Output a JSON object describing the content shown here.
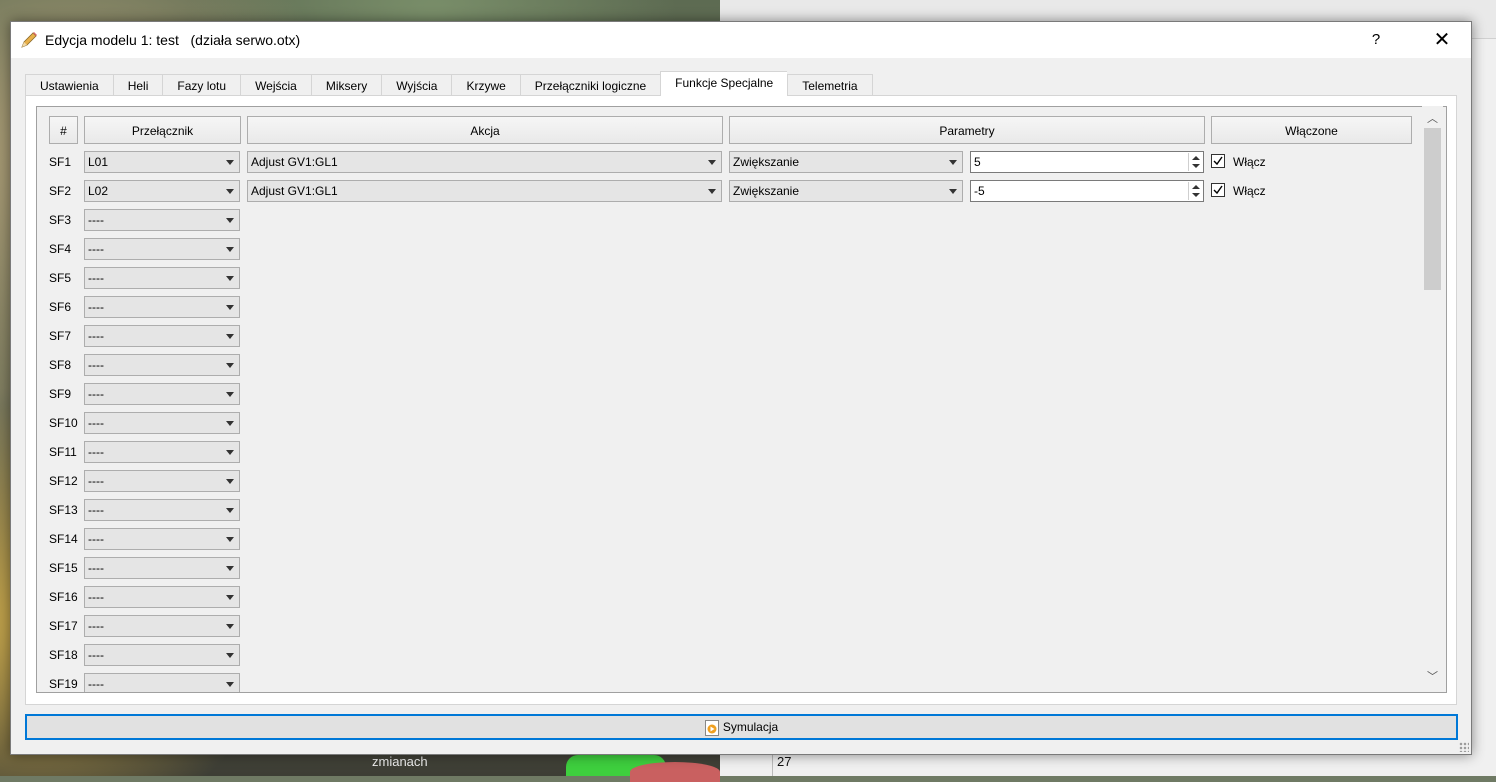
{
  "window": {
    "title": "Edycja modelu 1: test   (działa serwo.otx)",
    "help_label": "?",
    "close_label": "✕"
  },
  "tabs": [
    {
      "label": "Ustawienia",
      "active": false
    },
    {
      "label": "Heli",
      "active": false
    },
    {
      "label": "Fazy lotu",
      "active": false
    },
    {
      "label": "Wejścia",
      "active": false
    },
    {
      "label": "Miksery",
      "active": false
    },
    {
      "label": "Wyjścia",
      "active": false
    },
    {
      "label": "Krzywe",
      "active": false
    },
    {
      "label": "Przełączniki logiczne",
      "active": false
    },
    {
      "label": "Funkcje Specjalne",
      "active": true
    },
    {
      "label": "Telemetria",
      "active": false
    }
  ],
  "table": {
    "headers": {
      "num": "#",
      "switch": "Przełącznik",
      "action": "Akcja",
      "params": "Parametry",
      "enabled": "Włączone"
    },
    "rows": [
      {
        "id": "SF1",
        "switch": "L01",
        "action": "Adjust GV1:GL1",
        "param_mode": "Zwiększanie",
        "param_value": "5",
        "enabled": true,
        "enabled_label": "Włącz"
      },
      {
        "id": "SF2",
        "switch": "L02",
        "action": "Adjust GV1:GL1",
        "param_mode": "Zwiększanie",
        "param_value": "-5",
        "enabled": true,
        "enabled_label": "Włącz"
      },
      {
        "id": "SF3",
        "switch": "----"
      },
      {
        "id": "SF4",
        "switch": "----"
      },
      {
        "id": "SF5",
        "switch": "----"
      },
      {
        "id": "SF6",
        "switch": "----"
      },
      {
        "id": "SF7",
        "switch": "----"
      },
      {
        "id": "SF8",
        "switch": "----"
      },
      {
        "id": "SF9",
        "switch": "----"
      },
      {
        "id": "SF10",
        "switch": "----"
      },
      {
        "id": "SF11",
        "switch": "----"
      },
      {
        "id": "SF12",
        "switch": "----"
      },
      {
        "id": "SF13",
        "switch": "----"
      },
      {
        "id": "SF14",
        "switch": "----"
      },
      {
        "id": "SF15",
        "switch": "----"
      },
      {
        "id": "SF16",
        "switch": "----"
      },
      {
        "id": "SF17",
        "switch": "----"
      },
      {
        "id": "SF18",
        "switch": "----"
      },
      {
        "id": "SF19",
        "switch": "----"
      }
    ]
  },
  "footer": {
    "simulate_label": "Symulacja"
  },
  "background": {
    "caption": "zmianach",
    "number": "27"
  },
  "colors": {
    "accent": "#0078d7",
    "tab_page": "#ffffff",
    "dialog_bg": "#f0f0f0"
  }
}
